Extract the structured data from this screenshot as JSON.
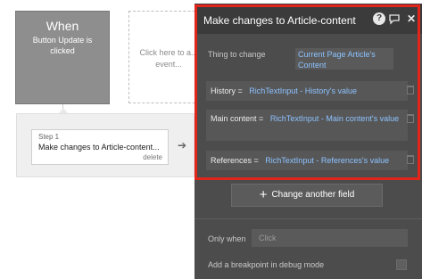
{
  "trigger": {
    "title": "When",
    "subtitle": "Button Update is clicked"
  },
  "placeholder_box": {
    "text": "Click here to a... event..."
  },
  "step": {
    "label": "Step 1",
    "title": "Make changes to Article-content...",
    "delete_label": "delete"
  },
  "editor": {
    "title": "Make changes to Article-content",
    "thing_label": "Thing to change",
    "thing_value": "Current Page Article's Content",
    "fields": [
      {
        "name": "History =",
        "value": "RichTextInput - History's value"
      },
      {
        "name": "Main content =",
        "value": "RichTextInput - Main content's value"
      },
      {
        "name": "References =",
        "value": "RichTextInput - References's value"
      }
    ],
    "change_button": "Change another field",
    "only_when_label": "Only when",
    "only_when_placeholder": "Click",
    "breakpoint_label": "Add a breakpoint in debug mode"
  },
  "colors": {
    "highlight": "#e1251b",
    "value_text": "#8cc2ff",
    "panel_bg": "#4c4c4c"
  },
  "icons": [
    "help-icon",
    "comment-icon",
    "close-icon",
    "arrow-right-icon",
    "trash-icon",
    "plus-icon"
  ]
}
